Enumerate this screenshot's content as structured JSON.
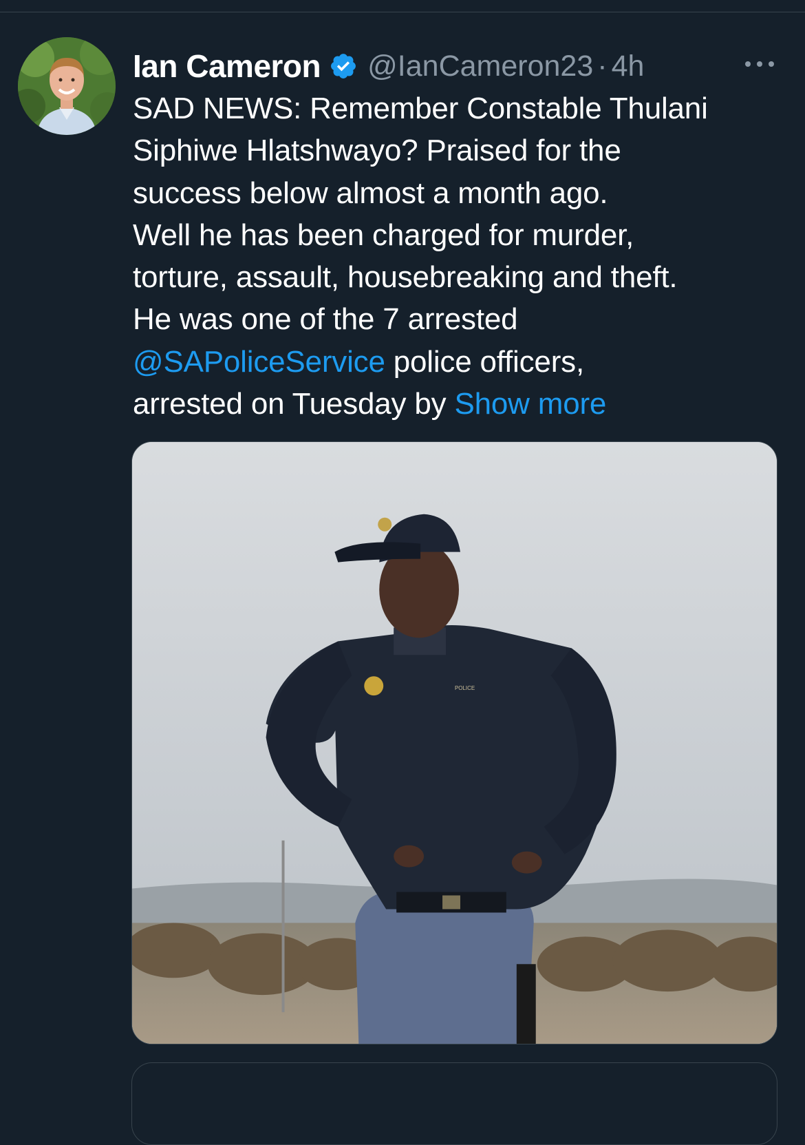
{
  "tweet": {
    "display_name": "Ian Cameron",
    "handle": "@IanCameron23",
    "separator": "·",
    "timestamp": "4h",
    "lines": [
      "SAD NEWS: Remember Constable Thulani",
      "Siphiwe Hlatshwayo? Praised for the",
      "success below almost a month ago.",
      "Well he has been charged for murder,",
      "torture, assault, housebreaking and theft.",
      "He was one of the 7 arrested"
    ],
    "mention": "@SAPoliceService",
    "after_mention": " police officers,",
    "last_line": "arrested on Tuesday by ",
    "show_more": "Show more",
    "badge_text": "POLICE"
  },
  "icons": {
    "verified": "verified-badge-icon",
    "more": "more-options-icon"
  },
  "colors": {
    "background": "#15202b",
    "link": "#1d9bf0",
    "muted": "#8b98a5",
    "divider": "#38444d"
  }
}
